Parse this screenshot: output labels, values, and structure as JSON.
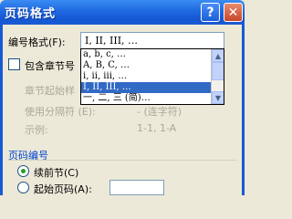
{
  "window": {
    "title": "页码格式",
    "help_glyph": "?",
    "close_glyph": "✕"
  },
  "number_format": {
    "label": "编号格式(F):",
    "value": "I, II, III, …",
    "options": [
      "a, b, c, …",
      "A, B, C, …",
      "i, ii, iii, …",
      "I, II, III, …",
      "一, 二, 三 (简)…"
    ],
    "selected_index": 3
  },
  "chapter": {
    "include_label": "包含章节号",
    "include_checked": false,
    "start_style_label": "章节起始样",
    "separator_label": "使用分隔符 (E):",
    "separator_value": "- (连字符)",
    "example_label": "示例:",
    "example_value": "1-1, 1-A"
  },
  "page_numbering": {
    "group_label": "页码编号",
    "continue_label": "续前节(C)",
    "start_at_label": "起始页码(A):",
    "selected": "continue"
  }
}
